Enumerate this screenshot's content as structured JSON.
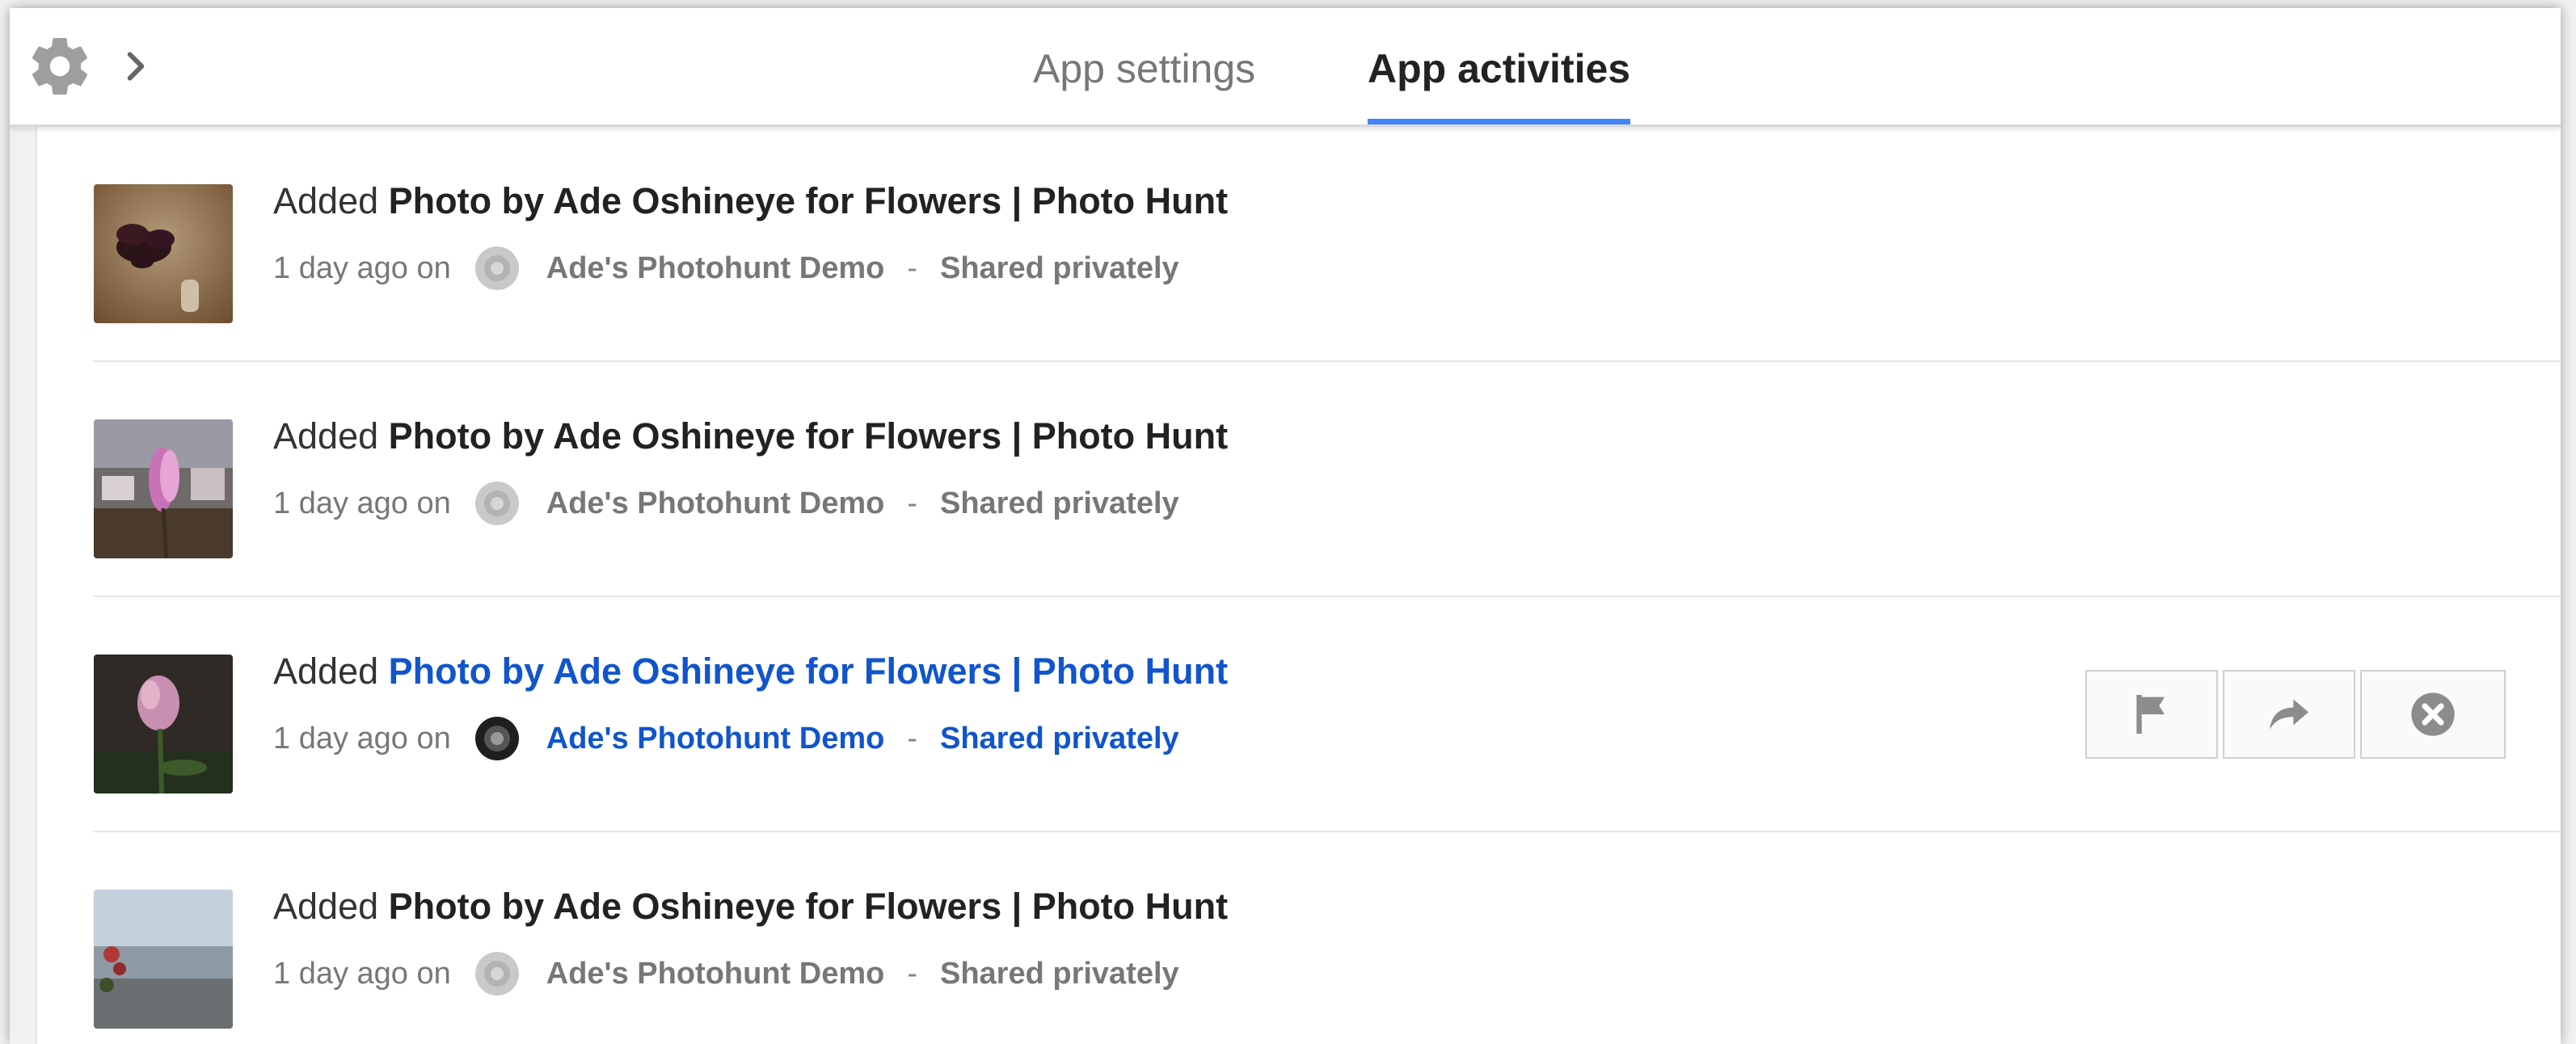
{
  "header": {
    "tabs": [
      {
        "label": "App settings",
        "active": false
      },
      {
        "label": "App activities",
        "active": true
      }
    ],
    "icons": [
      "gear-icon",
      "chevron-right-icon"
    ],
    "accent_color": "#4285f4"
  },
  "activities": [
    {
      "verb": "Added",
      "title": "Photo by Ade Oshineye for Flowers | Photo Hunt",
      "time": "1 day ago on",
      "source": "Ade's Photohunt Demo",
      "sep": "-",
      "visibility": "Shared privately"
    },
    {
      "verb": "Added",
      "title": "Photo by Ade Oshineye for Flowers | Photo Hunt",
      "time": "1 day ago on",
      "source": "Ade's Photohunt Demo",
      "sep": "-",
      "visibility": "Shared privately"
    },
    {
      "verb": "Added",
      "title": "Photo by Ade Oshineye for Flowers | Photo Hunt",
      "time": "1 day ago on",
      "source": "Ade's Photohunt Demo",
      "sep": "-",
      "visibility": "Shared privately",
      "hovered": true
    },
    {
      "verb": "Added",
      "title": "Photo by Ade Oshineye for Flowers | Photo Hunt",
      "time": "1 day ago on",
      "source": "Ade's Photohunt Demo",
      "sep": "-",
      "visibility": "Shared privately"
    }
  ],
  "row_actions": [
    "flag-icon",
    "share-icon",
    "close-icon"
  ],
  "link_color": "#1155cc"
}
